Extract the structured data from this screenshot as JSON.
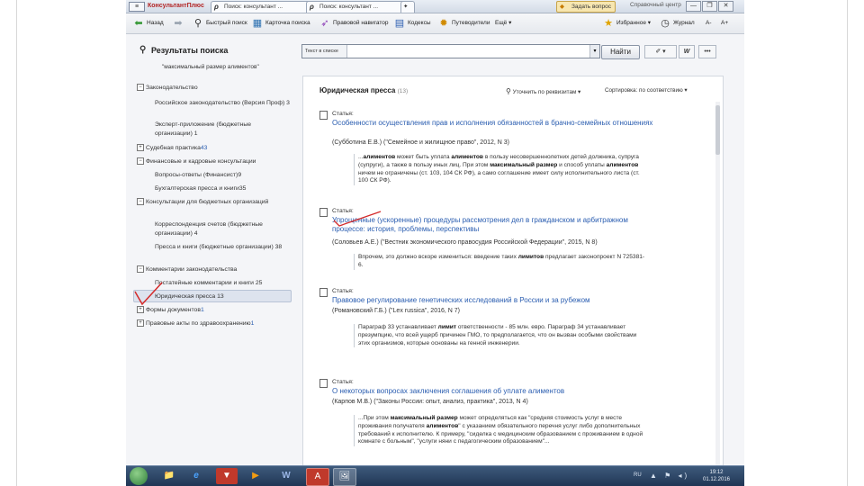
{
  "titlebar": {
    "menu_icon": "menu-icon",
    "brand": "КонсультантПлюс",
    "tabs": [
      {
        "label": "Поиск: консультант ...",
        "icon": "search-icon"
      },
      {
        "label": "Поиск: консультант ...",
        "icon": "search-icon"
      }
    ],
    "ask_label": "Задать вопрос",
    "help_label": "Справочный центр",
    "window_buttons": [
      "—",
      "❐",
      "✕"
    ]
  },
  "toolbar": {
    "back": "Назад",
    "forward": "",
    "quick_search": "Быстрый поиск",
    "card_search": "Карточка поиска",
    "legal_navigator": "Правовой навигатор",
    "codes": "Кодексы",
    "navigators": "Путеводители",
    "more": "Ещё",
    "favorites": "Избранное",
    "history": "Журнал",
    "font_minus": "A-",
    "font_plus": "A+"
  },
  "search": {
    "title": "Результаты поиска",
    "query": "\"максимальный размер алиментов\"",
    "scope_label": "Текст в списке",
    "value": "",
    "find_label": "Найти",
    "extra_buttons": [
      "✐ ▾",
      "W",
      "•••"
    ]
  },
  "tree": {
    "items": [
      {
        "label": "Законодательство",
        "pm": "−",
        "count": "",
        "sub": [
          {
            "label": "Российское законодательство (Версия Проф)",
            "count": "3"
          },
          {
            "label": "Эксперт-приложение (бюджетные организации)",
            "count": "1"
          }
        ]
      },
      {
        "label": "Судебная практика",
        "pm": "+",
        "count": "43",
        "sub": []
      },
      {
        "label": "Финансовые и кадровые консультации",
        "pm": "−",
        "count": "",
        "sub": [
          {
            "label": "Вопросы-ответы (Финансист)",
            "count": "9"
          },
          {
            "label": "Бухгалтерская пресса и книги",
            "count": "35"
          }
        ]
      },
      {
        "label": "Консультации для бюджетных организаций",
        "pm": "−",
        "count": "",
        "sub": [
          {
            "label": "Корреспонденция счетов (бюджетные организации)",
            "count": "4"
          },
          {
            "label": "Пресса и книги (бюджетные организации)",
            "count": "38"
          }
        ]
      },
      {
        "label": "Комментарии законодательства",
        "pm": "−",
        "count": "",
        "sub": [
          {
            "label": "Постатейные комментарии и книги",
            "count": "25"
          },
          {
            "label": "Юридическая пресса",
            "count": "13"
          }
        ]
      },
      {
        "label": "Формы документов",
        "pm": "+",
        "count": "1",
        "sub": []
      },
      {
        "label": "Правовые акты по здравоохранению",
        "pm": "+",
        "count": "1",
        "sub": []
      }
    ]
  },
  "panel": {
    "title": "Юридическая пресса",
    "count": "(13)",
    "refine_label": "Уточнить по реквизитам ▾",
    "sort_label": "Сортировка: по соответствию ▾",
    "entries": [
      {
        "kind": "Статья:",
        "title": "Особенности осуществления прав и исполнения обязанностей в брачно-семейных отношениях",
        "source": "(Субботина Е.В.) (\"Семейное и жилищное право\", 2012, N 3)",
        "snippet_parts": [
          {
            "t": "...",
            "b": false
          },
          {
            "t": "алиментов",
            "b": true
          },
          {
            "t": " может быть уплата ",
            "b": false
          },
          {
            "t": "алиментов",
            "b": true
          },
          {
            "t": " в пользу несовершеннолетних детей должника, супруга (супруги), а также в пользу иных лиц. При этом ",
            "b": false
          },
          {
            "t": "максимальный размер",
            "b": true
          },
          {
            "t": " и способ уплаты ",
            "b": false
          },
          {
            "t": "алиментов",
            "b": true
          },
          {
            "t": " ничем не ограничены (ст. 103, 104 СК РФ), а само соглашение имеет силу исполнительного листа (ст. 100 СК РФ).",
            "b": false
          }
        ]
      },
      {
        "kind": "Статья:",
        "title": "Упрощенные (ускоренные) процедуры рассмотрения дел в гражданском и арбитражном процессе: история, проблемы, перспективы",
        "source": "(Соловьев А.Е.) (\"Вестник экономического правосудия Российской Федерации\", 2015, N 8)",
        "snippet_parts": [
          {
            "t": "Впрочем, это должно вскоре измениться: введение таких ",
            "b": false
          },
          {
            "t": "лимитов",
            "b": true
          },
          {
            "t": " предлагает законопроект N 725381-6.",
            "b": false
          }
        ]
      },
      {
        "kind": "Статья:",
        "title": "Правовое регулирование генетических исследований в России и за рубежом",
        "source": "(Романовский Г.Б.) (\"Lex russica\", 2016, N 7)",
        "snippet_parts": [
          {
            "t": "Параграф 33 устанавливает ",
            "b": false
          },
          {
            "t": "лимит",
            "b": true
          },
          {
            "t": " ответственности - 85 млн. евро. Параграф 34 устанавливает презумпцию, что всей ущерб причинен ГМО, то предполагается, что он вызван особыми свойствами этих организмов, которые основаны на генной инженерии.",
            "b": false
          }
        ]
      },
      {
        "kind": "Статья:",
        "title": "О некоторых вопросах заключения соглашения об уплате алиментов",
        "source": "(Карпов М.В.) (\"Законы России: опыт, анализ, практика\", 2013, N 4)",
        "snippet_parts": [
          {
            "t": "...При этом ",
            "b": false
          },
          {
            "t": "максимальный размер",
            "b": true
          },
          {
            "t": " может определяться как \"средняя стоимость услуг в месте проживания получателя ",
            "b": false
          },
          {
            "t": "алиментов",
            "b": true
          },
          {
            "t": "\" с указанием обязательного перечня услуг либо дополнительных требований к исполнителю. К примеру, \"сиделка с медицинским образованием с проживанием в одной комнате с больным\", \"услуги няни с педагогическим образованием\"...",
            "b": false
          }
        ]
      }
    ]
  },
  "taskbar": {
    "apps": [
      "📁",
      "e",
      "▼",
      "▶",
      "W",
      "A",
      "🖼"
    ],
    "lang": "RU",
    "tray_icons": "▲ ⚑ ◂)",
    "time": "19:12",
    "date": "01.12.2016"
  }
}
